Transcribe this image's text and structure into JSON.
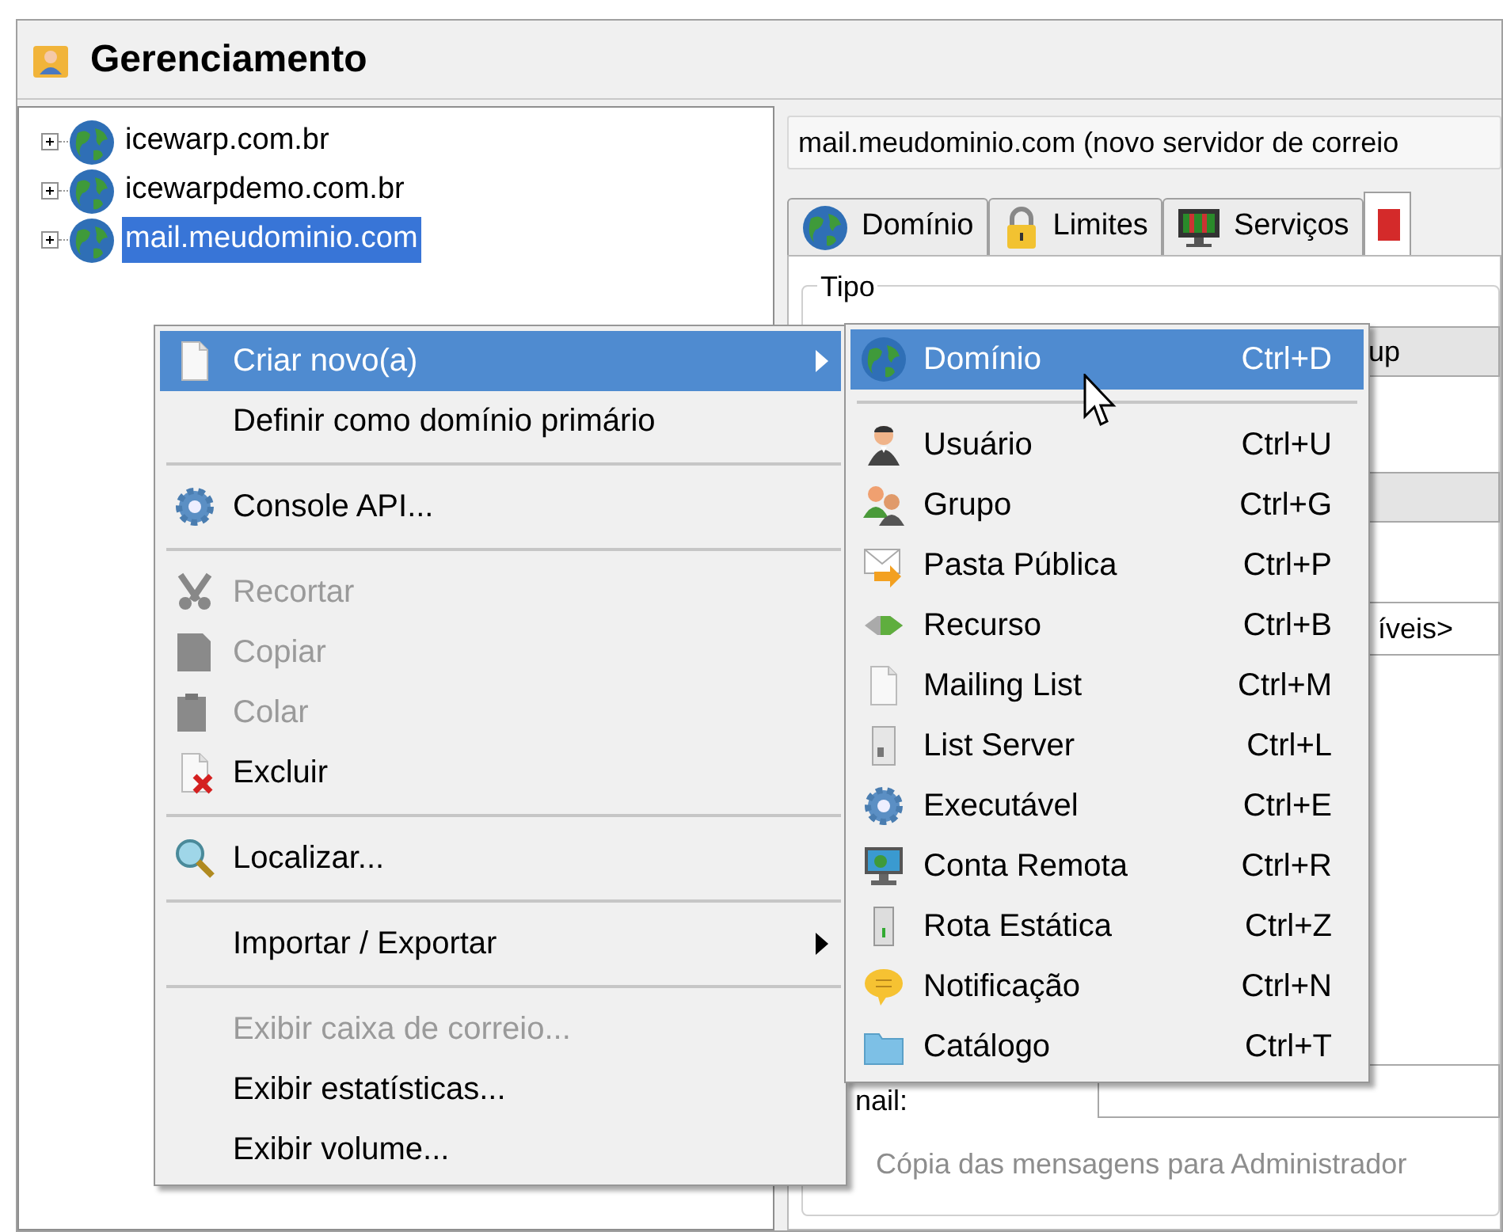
{
  "window": {
    "title": "Gerenciamento"
  },
  "tree": {
    "items": [
      {
        "label": "icewarp.com.br",
        "expanded": false,
        "selected": false
      },
      {
        "label": "icewarpdemo.com.br",
        "expanded": false,
        "selected": false
      },
      {
        "label": "mail.meudominio.com",
        "expanded": false,
        "selected": true
      }
    ]
  },
  "details": {
    "header": "mail.meudominio.com (novo servidor de correio",
    "tabs": [
      {
        "label": "Domínio",
        "selected": false
      },
      {
        "label": "Limites",
        "selected": false
      },
      {
        "label": "Serviços",
        "selected": false
      }
    ],
    "group_title": "Tipo",
    "type_button": "up",
    "combo_value": "íveis>",
    "email_label": "nail:",
    "copy_checkbox": {
      "label": "Cópia das mensagens para Administrador",
      "disabled": true
    }
  },
  "context_menu": {
    "items": [
      {
        "kind": "item",
        "label": "Criar novo(a)",
        "selected": true,
        "disabled": false,
        "has_submenu": true
      },
      {
        "kind": "item",
        "label": "Definir como domínio primário",
        "selected": false,
        "disabled": false,
        "has_submenu": false
      },
      {
        "kind": "separator"
      },
      {
        "kind": "item",
        "label": "Console API...",
        "selected": false,
        "disabled": false,
        "has_submenu": false
      },
      {
        "kind": "separator"
      },
      {
        "kind": "item",
        "label": "Recortar",
        "selected": false,
        "disabled": true,
        "has_submenu": false
      },
      {
        "kind": "item",
        "label": "Copiar",
        "selected": false,
        "disabled": true,
        "has_submenu": false
      },
      {
        "kind": "item",
        "label": "Colar",
        "selected": false,
        "disabled": true,
        "has_submenu": false
      },
      {
        "kind": "item",
        "label": "Excluir",
        "selected": false,
        "disabled": false,
        "has_submenu": false
      },
      {
        "kind": "separator"
      },
      {
        "kind": "item",
        "label": "Localizar...",
        "selected": false,
        "disabled": false,
        "has_submenu": false
      },
      {
        "kind": "separator"
      },
      {
        "kind": "item",
        "label": "Importar / Exportar",
        "selected": false,
        "disabled": false,
        "has_submenu": true
      },
      {
        "kind": "separator"
      },
      {
        "kind": "item",
        "label": "Exibir caixa de correio...",
        "selected": false,
        "disabled": true,
        "has_submenu": false
      },
      {
        "kind": "item",
        "label": "Exibir estatísticas...",
        "selected": false,
        "disabled": false,
        "has_submenu": false
      },
      {
        "kind": "item",
        "label": "Exibir volume...",
        "selected": false,
        "disabled": false,
        "has_submenu": false
      }
    ]
  },
  "submenu": {
    "items": [
      {
        "kind": "item",
        "label": "Domínio",
        "shortcut": "Ctrl+D",
        "selected": true
      },
      {
        "kind": "separator"
      },
      {
        "kind": "item",
        "label": "Usuário",
        "shortcut": "Ctrl+U",
        "selected": false
      },
      {
        "kind": "item",
        "label": "Grupo",
        "shortcut": "Ctrl+G",
        "selected": false
      },
      {
        "kind": "item",
        "label": "Pasta Pública",
        "shortcut": "Ctrl+P",
        "selected": false
      },
      {
        "kind": "item",
        "label": "Recurso",
        "shortcut": "Ctrl+B",
        "selected": false
      },
      {
        "kind": "item",
        "label": "Mailing List",
        "shortcut": "Ctrl+M",
        "selected": false
      },
      {
        "kind": "item",
        "label": "List Server",
        "shortcut": "Ctrl+L",
        "selected": false
      },
      {
        "kind": "item",
        "label": "Executável",
        "shortcut": "Ctrl+E",
        "selected": false
      },
      {
        "kind": "item",
        "label": "Conta Remota",
        "shortcut": "Ctrl+R",
        "selected": false
      },
      {
        "kind": "item",
        "label": "Rota Estática",
        "shortcut": "Ctrl+Z",
        "selected": false
      },
      {
        "kind": "item",
        "label": "Notificação",
        "shortcut": "Ctrl+N",
        "selected": false
      },
      {
        "kind": "item",
        "label": "Catálogo",
        "shortcut": "Ctrl+T",
        "selected": false
      }
    ]
  }
}
